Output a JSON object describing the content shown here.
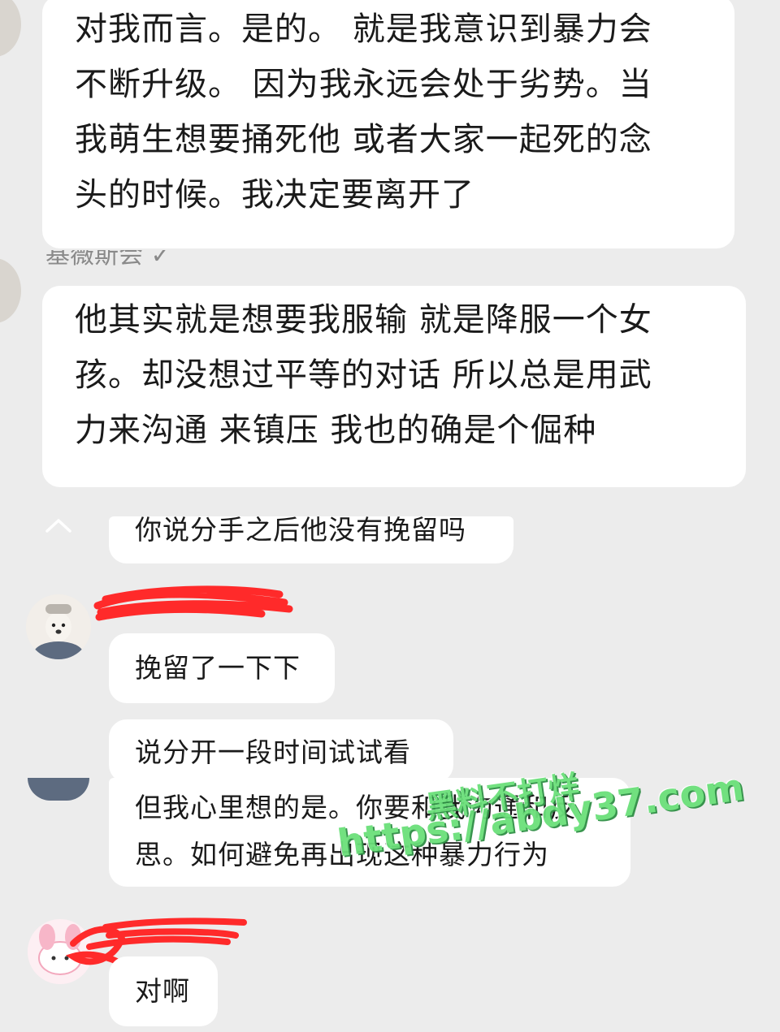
{
  "messages": [
    {
      "lines": [
        "对我而言。是的。 就是我意识到暴力会",
        "不断升级。 因为我永远会处于劣势。当",
        "我萌生想要捅死他 或者大家一起死的念",
        "头的时候。我决定要离开了"
      ]
    },
    {
      "lines": [
        "他其实就是想要我服输 就是降服一个女",
        "孩。却没想过平等的对话  所以总是用武",
        "力来沟通 来镇压   我也的确是个倔种"
      ]
    },
    {
      "lines": [
        "你说分手之后他没有挽留吗"
      ]
    },
    {
      "lines": [
        "挽留了一下下"
      ]
    },
    {
      "lines": [
        "说分开一段时间试试看"
      ]
    },
    {
      "lines": [
        "但我心里想的是。你要和我沟通和反",
        "思。如何避免再出现这种暴力行为"
      ]
    },
    {
      "lines": [
        "对啊"
      ]
    }
  ],
  "partial_nickname": "基薇斯会 ✓",
  "collapse_icon": "chevron-up-icon",
  "watermark": {
    "line1": "黑料不打烊",
    "line2": "https://abdy37.com"
  },
  "colors": {
    "background": "#ececec",
    "bubble": "#ffffff",
    "redaction": "#ff2a2a",
    "watermark": "#6be07a"
  }
}
